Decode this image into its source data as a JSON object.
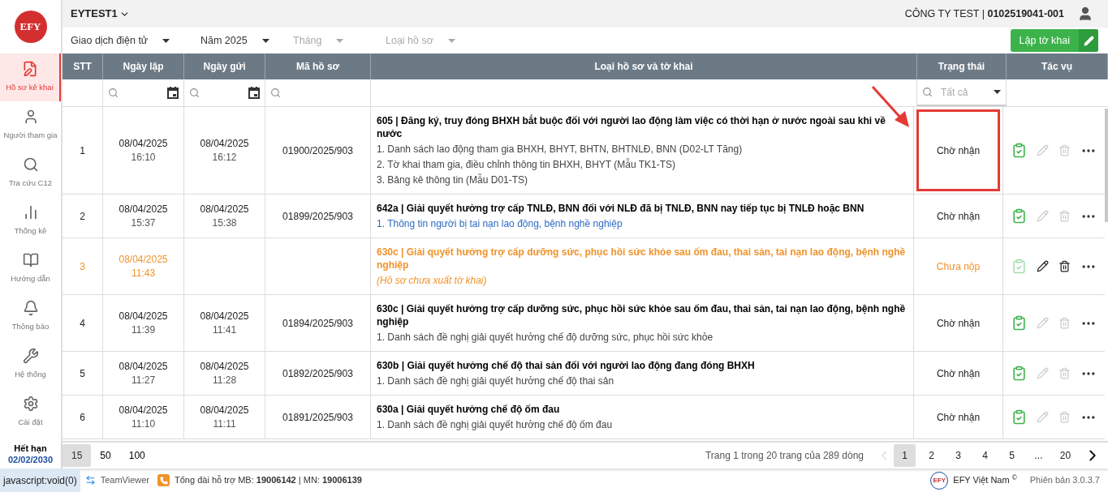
{
  "logo": {
    "text": "EFY"
  },
  "sidebar": {
    "items": [
      {
        "label": "Hồ sơ kê khai",
        "selected": true
      },
      {
        "label": "Người tham gia",
        "selected": false
      },
      {
        "label": "Tra cứu C12",
        "selected": false
      },
      {
        "label": "Thống kê",
        "selected": false
      },
      {
        "label": "Hướng dẫn",
        "selected": false
      },
      {
        "label": "Thông báo",
        "selected": false
      },
      {
        "label": "Hệ thống",
        "selected": false
      },
      {
        "label": "Cài đặt",
        "selected": false
      }
    ],
    "expiry": {
      "label": "Hết hạn",
      "date": "02/02/2030"
    }
  },
  "header": {
    "account": "EYTEST1",
    "company": "CÔNG TY TEST | **0102519041-001**"
  },
  "filters": [
    {
      "label": "Giao dịch điện tử",
      "disabled": false
    },
    {
      "label": "Năm 2025",
      "disabled": false
    },
    {
      "label": "Tháng",
      "disabled": true
    },
    {
      "label": "Loại hồ sơ",
      "disabled": true
    }
  ],
  "create_button": {
    "label": "Lập tờ khai"
  },
  "table": {
    "columns": [
      "STT",
      "Ngày lập",
      "Ngày gửi",
      "Mã hồ sơ",
      "Loại hồ sơ và tờ khai",
      "Trạng thái",
      "Tác vụ"
    ],
    "status_filter": {
      "placeholder": "Tất cả"
    },
    "rows": [
      {
        "kind": "sent",
        "stt": "1",
        "created_date": "08/04/2025",
        "created_time": "16:10",
        "sent_date": "08/04/2025",
        "sent_time": "16:12",
        "code": "01900/2025/903",
        "title": "605 | Đăng ký, truy đóng BHXH bắt buộc đối với người lao động làm việc có thời hạn ở nước ngoài sau khi về nước",
        "lines": [
          {
            "kind": "item",
            "text": "1. Danh sách lao động tham gia BHXH, BHYT, BHTN, BHTNLĐ, BNN (D02-LT Tăng)"
          },
          {
            "kind": "item",
            "text": "2. Tờ khai tham gia, điều chỉnh thông tin BHXH, BHYT (Mẫu TK1-TS)"
          },
          {
            "kind": "item",
            "text": "3. Bảng kê thông tin (Mẫu D01-TS)"
          }
        ],
        "status": "Chờ nhận",
        "highlighted": true
      },
      {
        "kind": "sent",
        "stt": "2",
        "created_date": "08/04/2025",
        "created_time": "15:37",
        "sent_date": "08/04/2025",
        "sent_time": "15:38",
        "code": "01899/2025/903",
        "title": "642a | Giải quyết hưởng trợ cấp TNLĐ, BNN đối với NLĐ đã bị TNLĐ, BNN nay tiếp tục bị TNLĐ hoặc BNN",
        "lines": [
          {
            "kind": "link",
            "text": "1. Thông tin người bị tai nạn lao động, bệnh nghề nghiệp"
          }
        ],
        "status": "Chờ nhận",
        "highlighted": false
      },
      {
        "kind": "draft",
        "stt": "3",
        "created_date": "08/04/2025",
        "created_time": "11:43",
        "title": "630c | Giải quyết hưởng trợ cấp dưỡng sức, phục hồi sức khỏe sau ốm đau, thai sản, tai nạn lao động, bệnh nghề nghiệp",
        "lines": [
          {
            "kind": "note",
            "text": "(Hồ sơ chưa xuất tờ khai)"
          }
        ],
        "status": "Chưa nộp",
        "highlighted": false
      },
      {
        "kind": "sent",
        "stt": "4",
        "created_date": "08/04/2025",
        "created_time": "11:39",
        "sent_date": "08/04/2025",
        "sent_time": "11:41",
        "code": "01894/2025/903",
        "title": "630c | Giải quyết hưởng trợ cấp dưỡng sức, phục hồi sức khỏe sau ốm đau, thai sản, tai nạn lao động, bệnh nghề nghiệp",
        "lines": [
          {
            "kind": "item",
            "text": "1. Danh sách đề nghị giải quyết hưởng chế độ dưỡng sức, phục hồi sức khỏe"
          }
        ],
        "status": "Chờ nhận",
        "highlighted": false
      },
      {
        "kind": "sent",
        "stt": "5",
        "created_date": "08/04/2025",
        "created_time": "11:27",
        "sent_date": "08/04/2025",
        "sent_time": "11:28",
        "code": "01892/2025/903",
        "title": "630b | Giải quyết hưởng chế độ thai sản đối với người lao động đang đóng BHXH",
        "lines": [
          {
            "kind": "item",
            "text": "1. Danh sách đề nghị giải quyết hưởng chế độ thai sản"
          }
        ],
        "status": "Chờ nhận",
        "highlighted": false
      },
      {
        "kind": "sent",
        "stt": "6",
        "created_date": "08/04/2025",
        "created_time": "11:10",
        "sent_date": "08/04/2025",
        "sent_time": "11:11",
        "code": "01891/2025/903",
        "title": "630a | Giải quyết hưởng chế độ ốm đau",
        "lines": [
          {
            "kind": "item",
            "text": "1. Danh sách đề nghị giải quyết hưởng chế độ ốm đau"
          }
        ],
        "status": "Chờ nhận",
        "highlighted": false
      }
    ]
  },
  "pagination": {
    "page_sizes": [
      {
        "label": "15",
        "selected": true
      },
      {
        "label": "50",
        "selected": false
      },
      {
        "label": "100",
        "selected": false
      }
    ],
    "summary": "Trang 1 trong 20 trang của 289 dòng",
    "prev_disabled": true,
    "pages": [
      {
        "label": "1",
        "selected": true
      },
      {
        "label": "2",
        "selected": false
      },
      {
        "label": "3",
        "selected": false
      },
      {
        "label": "4",
        "selected": false
      },
      {
        "label": "5",
        "selected": false
      },
      {
        "label": "...",
        "selected": false
      },
      {
        "label": "20",
        "selected": false
      }
    ]
  },
  "footer": {
    "url": "javascript:void(0)",
    "teamviewer": "TeamViewer",
    "hotline": "Tổng đài hỗ trợ MB: **19006142** | MN: **19006139**",
    "brand_logo": "EFY",
    "brand": "EFY Việt Nam $^{©}$",
    "version": "Phiên bản 3.0.3.7"
  }
}
